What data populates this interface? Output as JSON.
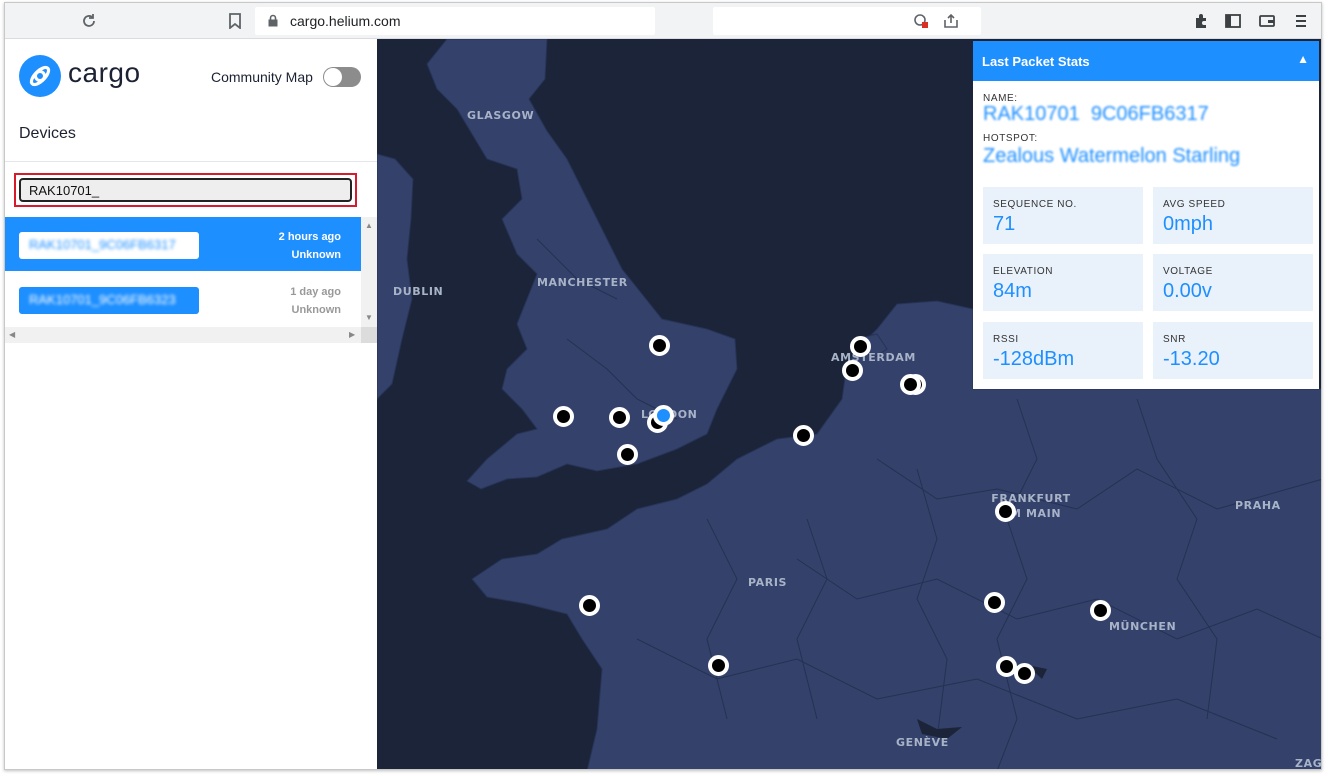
{
  "browser": {
    "url": "cargo.helium.com",
    "icons": [
      "reload-icon",
      "bookmark-icon",
      "lock-icon",
      "blocked-popup-icon",
      "share-icon",
      "extensions-icon",
      "sidebar-icon",
      "wallet-icon",
      "menu-icon"
    ]
  },
  "sidebar": {
    "brand": "cargo",
    "community_map_label": "Community Map",
    "community_map_on": false,
    "devices_title": "Devices",
    "search_value": "RAK10701_",
    "devices": [
      {
        "name": "RAK10701_9C06FB6317",
        "time": "2 hours ago",
        "status": "Unknown",
        "selected": true
      },
      {
        "name": "RAK10701_9C06FB6323",
        "time": "1 day ago",
        "status": "Unknown",
        "selected": false
      }
    ]
  },
  "map": {
    "cities": [
      "GLASGOW",
      "MANCHESTER",
      "DUBLIN",
      "AMSTERDAM",
      "LONDON",
      "FRANKFURT AM MAIN",
      "PRAHA",
      "PARIS",
      "MÜNCHEN",
      "GENÈVE",
      "ZAG"
    ],
    "hotspot_count": 19
  },
  "stats": {
    "title": "Last Packet Stats",
    "name_label": "NAME:",
    "name_value": "RAK10701_9C06FB6317",
    "hotspot_label": "HOTSPOT:",
    "hotspot_value": "Zealous Watermelon Starling",
    "cards": [
      {
        "label": "SEQUENCE NO.",
        "value": "71"
      },
      {
        "label": "AVG SPEED",
        "value": "0mph"
      },
      {
        "label": "ELEVATION",
        "value": "84m"
      },
      {
        "label": "VOLTAGE",
        "value": "0.00v"
      },
      {
        "label": "RSSI",
        "value": "-128dBm"
      },
      {
        "label": "SNR",
        "value": "-13.20"
      }
    ],
    "accent": "#1e8fff"
  }
}
